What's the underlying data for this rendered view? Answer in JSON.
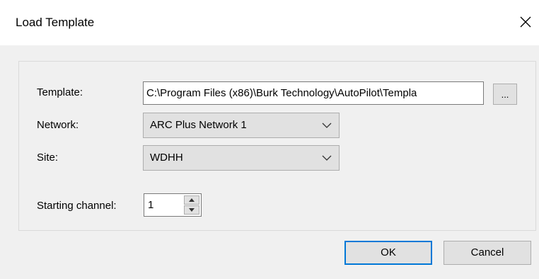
{
  "window": {
    "title": "Load Template",
    "close_glyph": "close-icon"
  },
  "form": {
    "template_label": "Template:",
    "template_value": "C:\\Program Files (x86)\\Burk Technology\\AutoPilot\\Templa",
    "browse_label": "...",
    "network_label": "Network:",
    "network_value": "ARC Plus Network 1",
    "site_label": "Site:",
    "site_value": "WDHH",
    "starting_channel_label": "Starting channel:",
    "starting_channel_value": "1"
  },
  "buttons": {
    "ok_label": "OK",
    "cancel_label": "Cancel"
  },
  "colors": {
    "default_button_border": "#0078d7",
    "dialog_bg": "#f0f0f0",
    "titlebar_bg": "#ffffff"
  }
}
